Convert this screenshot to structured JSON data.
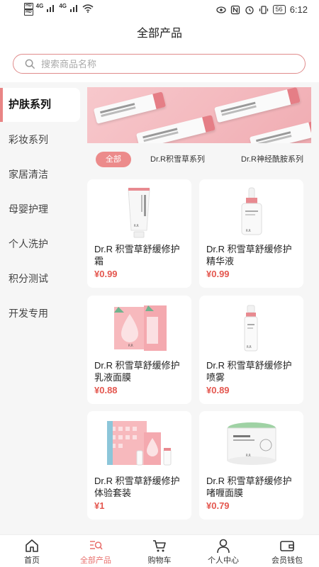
{
  "status_bar": {
    "network_left_1": "HD",
    "network_left_2": "HD",
    "signal_1": "4G",
    "signal_2": "4G",
    "battery": "56",
    "time": "6:12"
  },
  "header": {
    "title": "全部产品"
  },
  "search": {
    "placeholder": "搜索商品名称"
  },
  "sidebar": {
    "items": [
      {
        "label": "护肤系列",
        "active": true
      },
      {
        "label": "彩妆系列"
      },
      {
        "label": "家居清洁"
      },
      {
        "label": "母婴护理"
      },
      {
        "label": "个人洗护"
      },
      {
        "label": "积分测试"
      },
      {
        "label": "开发专用"
      }
    ]
  },
  "categories": [
    {
      "label": "全部",
      "active": true
    },
    {
      "label": "Dr.R积雪草系列"
    },
    {
      "label": "Dr.R神经酰胺系列"
    }
  ],
  "products": [
    {
      "title": "Dr.R 积雪草舒缓修护霜",
      "price": "¥0.99",
      "image": "cream-tube"
    },
    {
      "title": "Dr.R 积雪草舒缓修护精华液",
      "price": "¥0.99",
      "image": "serum-dropper-bottle"
    },
    {
      "title": "Dr.R 积雪草舒缓修护乳液面膜",
      "price": "¥0.88",
      "image": "mask-box"
    },
    {
      "title": "Dr.R 积雪草舒缓修护喷雾",
      "price": "¥0.89",
      "image": "spray-bottle"
    },
    {
      "title": "Dr.R 积雪草舒缓修护体验套装",
      "price": "¥1",
      "image": "trial-set"
    },
    {
      "title": "Dr.R 积雪草舒缓修护啫喱面膜",
      "price": "¥0.79",
      "image": "gel-mask-jar"
    }
  ],
  "bottom_nav": [
    {
      "label": "首页",
      "icon": "home-icon"
    },
    {
      "label": "全部产品",
      "icon": "search-list-icon",
      "active": true
    },
    {
      "label": "购物车",
      "icon": "cart-icon"
    },
    {
      "label": "个人中心",
      "icon": "user-icon"
    },
    {
      "label": "会员钱包",
      "icon": "wallet-icon"
    }
  ],
  "colors": {
    "accent": "#e98585",
    "price": "#e4574f",
    "search_border": "#e08c8c",
    "background": "#f6f6f6"
  }
}
